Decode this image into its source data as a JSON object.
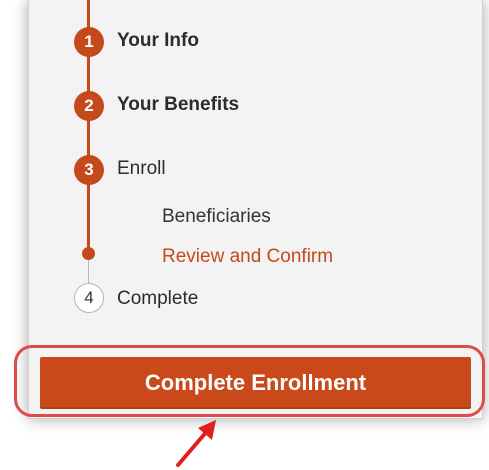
{
  "steps": [
    {
      "number": "1",
      "label": "Your Info"
    },
    {
      "number": "2",
      "label": "Your Benefits"
    },
    {
      "number": "3",
      "label": "Enroll"
    },
    {
      "number": "4",
      "label": "Complete"
    }
  ],
  "substeps": [
    {
      "label": "Beneficiaries"
    },
    {
      "label": "Review and Confirm"
    }
  ],
  "cta": {
    "label": "Complete Enrollment"
  },
  "colors": {
    "accent": "#c44a1c",
    "highlight": "#df4a4a",
    "panel_bg": "#f3f3f3"
  }
}
